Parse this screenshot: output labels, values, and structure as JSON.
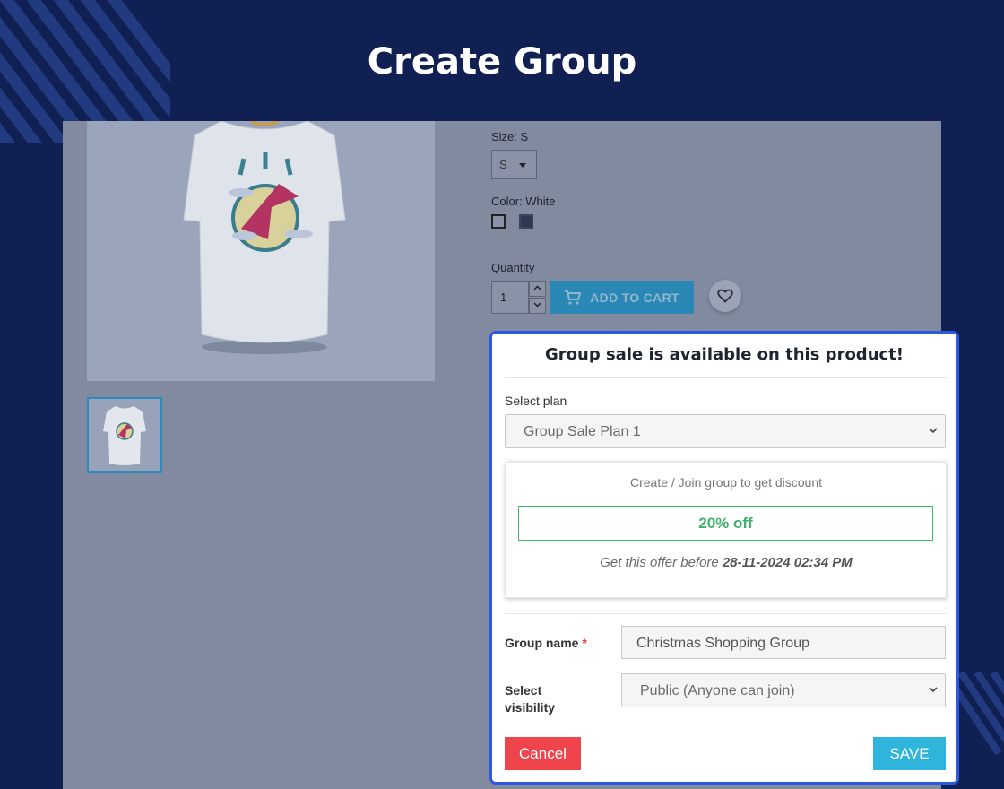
{
  "page": {
    "title": "Create Group"
  },
  "product": {
    "size_label": "Size: S",
    "size_value": "S",
    "color_label": "Color: White",
    "quantity_label": "Quantity",
    "quantity_value": "1",
    "add_to_cart_label": "ADD TO CART"
  },
  "modal": {
    "title": "Group sale is available on this product!",
    "select_plan_label": "Select plan",
    "plan_value": "Group Sale Plan 1",
    "offer_heading": "Create / Join group to get discount",
    "discount": "20% off",
    "offer_prefix": "Get this offer before ",
    "offer_deadline": "28-11-2024 02:34 PM",
    "group_name_label": "Group name",
    "required_mark": "*",
    "group_name_value": "Christmas Shopping Group",
    "visibility_label_line1": "Select",
    "visibility_label_line2": "visibility",
    "visibility_value": "Public (Anyone can join)",
    "cancel_label": "Cancel",
    "save_label": "SAVE"
  },
  "colors": {
    "background": "#102052",
    "modal_border": "#2d58e0",
    "cancel": "#f0444c",
    "save": "#2fb5dc",
    "discount": "#3fb26a"
  }
}
